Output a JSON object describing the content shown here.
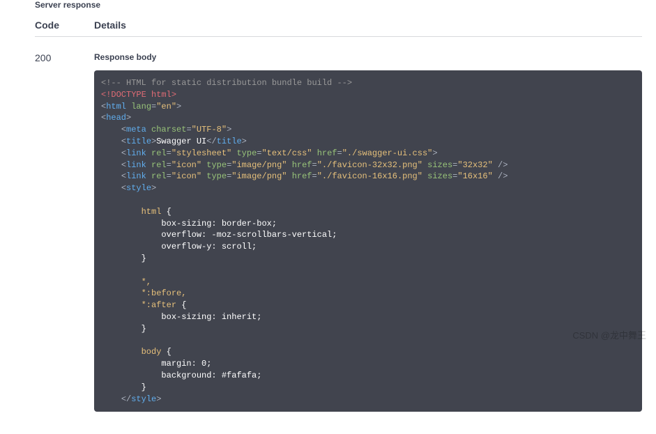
{
  "section_title": "Server response",
  "headers": {
    "code": "Code",
    "details": "Details"
  },
  "response": {
    "code": "200",
    "body_title": "Response body"
  },
  "code_tokens": [
    {
      "cls": "tok-comment",
      "t": "<!-- HTML for static distribution bundle build -->"
    },
    {
      "t": "\n"
    },
    {
      "cls": "tok-doctype",
      "t": "<!DOCTYPE html>"
    },
    {
      "t": "\n"
    },
    {
      "cls": "tok-punct",
      "t": "<"
    },
    {
      "cls": "tok-tag",
      "t": "html"
    },
    {
      "t": " "
    },
    {
      "cls": "tok-attr",
      "t": "lang"
    },
    {
      "cls": "tok-punct",
      "t": "="
    },
    {
      "cls": "tok-string",
      "t": "\"en\""
    },
    {
      "cls": "tok-punct",
      "t": ">"
    },
    {
      "t": "\n"
    },
    {
      "cls": "tok-punct",
      "t": "<"
    },
    {
      "cls": "tok-tag",
      "t": "head"
    },
    {
      "cls": "tok-punct",
      "t": ">"
    },
    {
      "t": "\n    "
    },
    {
      "cls": "tok-punct",
      "t": "<"
    },
    {
      "cls": "tok-tag",
      "t": "meta"
    },
    {
      "t": " "
    },
    {
      "cls": "tok-attr",
      "t": "charset"
    },
    {
      "cls": "tok-punct",
      "t": "="
    },
    {
      "cls": "tok-string",
      "t": "\"UTF-8\""
    },
    {
      "cls": "tok-punct",
      "t": ">"
    },
    {
      "t": "\n    "
    },
    {
      "cls": "tok-punct",
      "t": "<"
    },
    {
      "cls": "tok-tag",
      "t": "title"
    },
    {
      "cls": "tok-punct",
      "t": ">"
    },
    {
      "cls": "tok-text",
      "t": "Swagger UI"
    },
    {
      "cls": "tok-punct",
      "t": "</"
    },
    {
      "cls": "tok-tag",
      "t": "title"
    },
    {
      "cls": "tok-punct",
      "t": ">"
    },
    {
      "t": "\n    "
    },
    {
      "cls": "tok-punct",
      "t": "<"
    },
    {
      "cls": "tok-tag",
      "t": "link"
    },
    {
      "t": " "
    },
    {
      "cls": "tok-attr",
      "t": "rel"
    },
    {
      "cls": "tok-punct",
      "t": "="
    },
    {
      "cls": "tok-string",
      "t": "\"stylesheet\""
    },
    {
      "t": " "
    },
    {
      "cls": "tok-attr",
      "t": "type"
    },
    {
      "cls": "tok-punct",
      "t": "="
    },
    {
      "cls": "tok-string",
      "t": "\"text/css\""
    },
    {
      "t": " "
    },
    {
      "cls": "tok-attr",
      "t": "href"
    },
    {
      "cls": "tok-punct",
      "t": "="
    },
    {
      "cls": "tok-string",
      "t": "\"./swagger-ui.css\""
    },
    {
      "cls": "tok-punct",
      "t": ">"
    },
    {
      "t": "\n    "
    },
    {
      "cls": "tok-punct",
      "t": "<"
    },
    {
      "cls": "tok-tag",
      "t": "link"
    },
    {
      "t": " "
    },
    {
      "cls": "tok-attr",
      "t": "rel"
    },
    {
      "cls": "tok-punct",
      "t": "="
    },
    {
      "cls": "tok-string",
      "t": "\"icon\""
    },
    {
      "t": " "
    },
    {
      "cls": "tok-attr",
      "t": "type"
    },
    {
      "cls": "tok-punct",
      "t": "="
    },
    {
      "cls": "tok-string",
      "t": "\"image/png\""
    },
    {
      "t": " "
    },
    {
      "cls": "tok-attr",
      "t": "href"
    },
    {
      "cls": "tok-punct",
      "t": "="
    },
    {
      "cls": "tok-string",
      "t": "\"./favicon-32x32.png\""
    },
    {
      "t": " "
    },
    {
      "cls": "tok-attr",
      "t": "sizes"
    },
    {
      "cls": "tok-punct",
      "t": "="
    },
    {
      "cls": "tok-string",
      "t": "\"32x32\""
    },
    {
      "t": " "
    },
    {
      "cls": "tok-punct",
      "t": "/>"
    },
    {
      "t": "\n    "
    },
    {
      "cls": "tok-punct",
      "t": "<"
    },
    {
      "cls": "tok-tag",
      "t": "link"
    },
    {
      "t": " "
    },
    {
      "cls": "tok-attr",
      "t": "rel"
    },
    {
      "cls": "tok-punct",
      "t": "="
    },
    {
      "cls": "tok-string",
      "t": "\"icon\""
    },
    {
      "t": " "
    },
    {
      "cls": "tok-attr",
      "t": "type"
    },
    {
      "cls": "tok-punct",
      "t": "="
    },
    {
      "cls": "tok-string",
      "t": "\"image/png\""
    },
    {
      "t": " "
    },
    {
      "cls": "tok-attr",
      "t": "href"
    },
    {
      "cls": "tok-punct",
      "t": "="
    },
    {
      "cls": "tok-string",
      "t": "\"./favicon-16x16.png\""
    },
    {
      "t": " "
    },
    {
      "cls": "tok-attr",
      "t": "sizes"
    },
    {
      "cls": "tok-punct",
      "t": "="
    },
    {
      "cls": "tok-string",
      "t": "\"16x16\""
    },
    {
      "t": " "
    },
    {
      "cls": "tok-punct",
      "t": "/>"
    },
    {
      "t": "\n    "
    },
    {
      "cls": "tok-punct",
      "t": "<"
    },
    {
      "cls": "tok-tag",
      "t": "style"
    },
    {
      "cls": "tok-punct",
      "t": ">"
    },
    {
      "t": "\n\n        "
    },
    {
      "cls": "tok-css-sel",
      "t": "html"
    },
    {
      "t": " {\n            "
    },
    {
      "cls": "tok-css-prop",
      "t": "box-sizing: border-box;"
    },
    {
      "t": "\n            "
    },
    {
      "cls": "tok-css-prop",
      "t": "overflow: -moz-scrollbars-vertical;"
    },
    {
      "t": "\n            "
    },
    {
      "cls": "tok-css-prop",
      "t": "overflow-y: scroll;"
    },
    {
      "t": "\n        }\n\n        "
    },
    {
      "cls": "tok-css-sel",
      "t": "*,"
    },
    {
      "t": "\n        "
    },
    {
      "cls": "tok-css-sel",
      "t": "*:before,"
    },
    {
      "t": "\n        "
    },
    {
      "cls": "tok-css-sel",
      "t": "*:after"
    },
    {
      "t": " {\n            "
    },
    {
      "cls": "tok-css-prop",
      "t": "box-sizing: inherit;"
    },
    {
      "t": "\n        }\n\n        "
    },
    {
      "cls": "tok-css-sel",
      "t": "body"
    },
    {
      "t": " {\n            "
    },
    {
      "cls": "tok-css-prop",
      "t": "margin: 0;"
    },
    {
      "t": "\n            "
    },
    {
      "cls": "tok-css-prop",
      "t": "background: #fafafa;"
    },
    {
      "t": "\n        }\n    "
    },
    {
      "cls": "tok-punct",
      "t": "</"
    },
    {
      "cls": "tok-tag",
      "t": "style"
    },
    {
      "cls": "tok-punct",
      "t": ">"
    }
  ],
  "watermark": "CSDN @龙中舞王"
}
